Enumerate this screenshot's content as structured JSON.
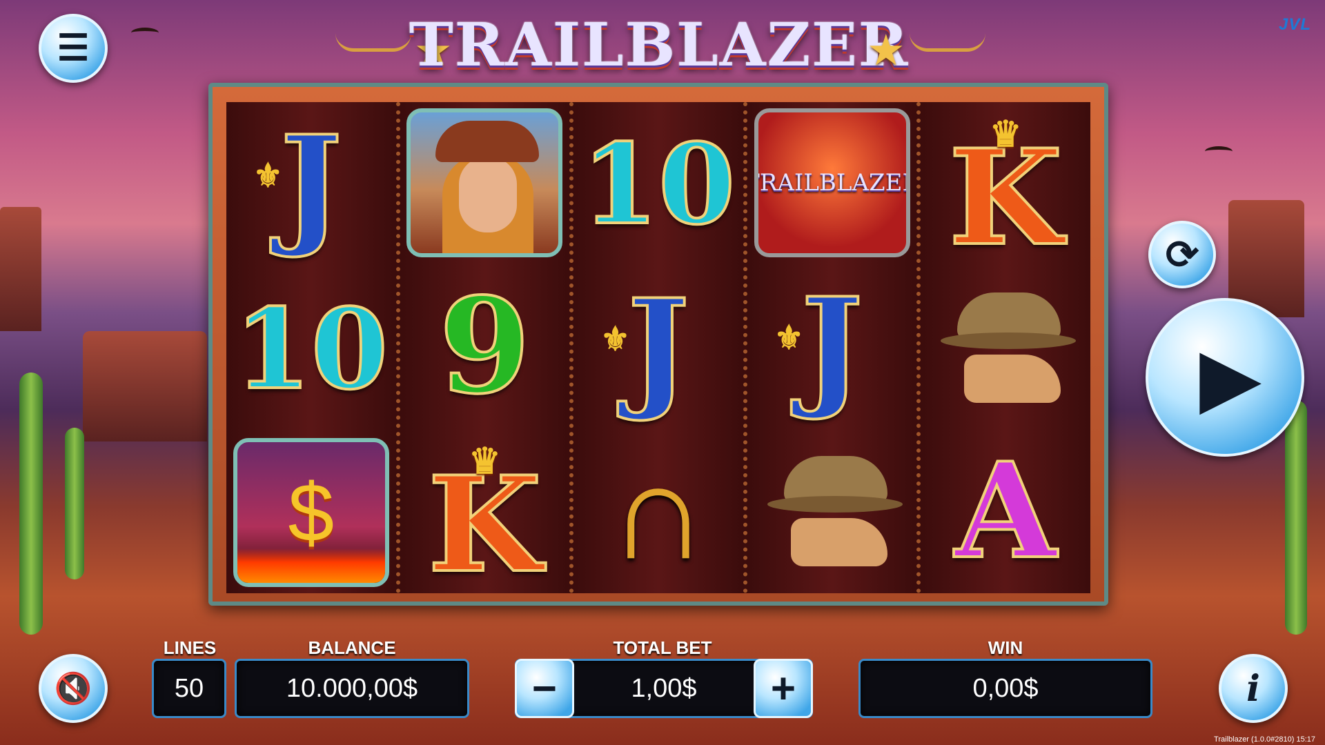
{
  "game": {
    "title": "TRAILBLAZER",
    "brand": "JVL",
    "version": "Trailblazer (1.0.0#2810) 15:17"
  },
  "buttons": {
    "menu_icon": "hamburger-menu-icon",
    "refresh_icon": "autoplay-refresh-icon",
    "spin_icon": "play-icon",
    "sound_icon": "sound-muted-icon",
    "info_label": "i",
    "minus_label": "−",
    "plus_label": "+"
  },
  "reels": [
    {
      "symbols": [
        "J",
        "cowgirl",
        "10"
      ]
    },
    {
      "symbols": [
        "cowgirl",
        "9",
        "K"
      ]
    },
    {
      "symbols": [
        "10",
        "J",
        "horseshoe"
      ]
    },
    {
      "symbols": [
        "trailblazer-logo",
        "J",
        "hat-and-boots"
      ]
    },
    {
      "symbols": [
        "K",
        "hat-and-boots",
        "A"
      ]
    }
  ],
  "symbols_text": {
    "r1s1": "J",
    "r1s2": "10",
    "r1s3": "$",
    "r2s2": "9",
    "r2s3": "K",
    "r3s1": "10",
    "r3s2": "J",
    "r4s1": "TRAILBLAZER",
    "r4s2": "J",
    "r5s1": "K",
    "r5s3": "A"
  },
  "bottom_bar": {
    "lines_label": "LINES",
    "lines_value": "50",
    "balance_label": "BALANCE",
    "balance_value": "10.000,00$",
    "total_bet_label": "TOTAL BET",
    "total_bet_value": "1,00$",
    "win_label": "WIN",
    "win_value": "0,00$"
  },
  "colors": {
    "button_blue": "#3fa6e8",
    "frame_teal": "#5e8a86",
    "reel_bg": "#3a0d0d"
  }
}
